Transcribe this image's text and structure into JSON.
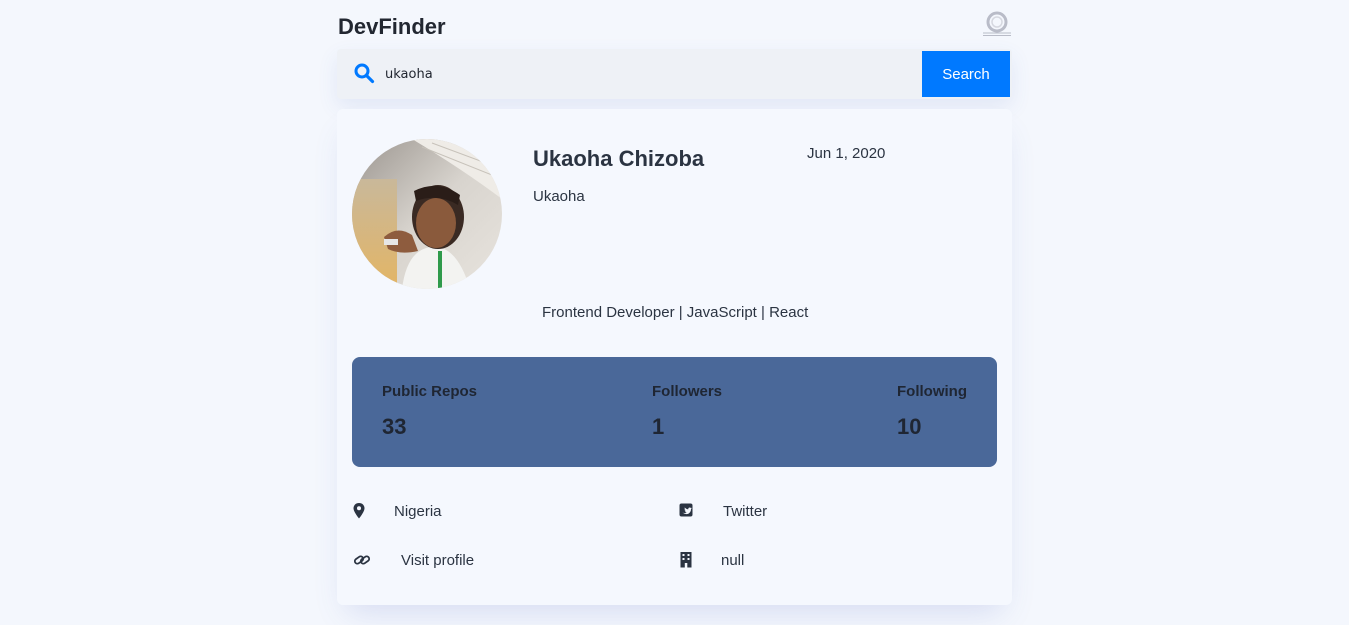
{
  "header": {
    "brand": "DevFinder"
  },
  "search": {
    "query": "ukaoha",
    "button_label": "Search"
  },
  "profile": {
    "name": "Ukaoha Chizoba",
    "joined": "Jun 1, 2020",
    "login": "Ukaoha",
    "bio": "Frontend Developer | JavaScript | React"
  },
  "stats": [
    {
      "label": "Public Repos",
      "value": "33"
    },
    {
      "label": "Followers",
      "value": "1"
    },
    {
      "label": "Following",
      "value": "10"
    }
  ],
  "links": {
    "location": {
      "text": "Nigeria",
      "icon": "map-pin-icon"
    },
    "twitter": {
      "text": "Twitter",
      "icon": "twitter-square-icon"
    },
    "website": {
      "text": "Visit profile",
      "icon": "link-icon"
    },
    "company": {
      "text": "null",
      "icon": "building-icon"
    }
  },
  "colors": {
    "accent": "#0079ff",
    "stats_background": "#4a6899",
    "page_background": "#f4f7fd",
    "card_background": "#f5f8fe",
    "text": "#2b3442"
  }
}
